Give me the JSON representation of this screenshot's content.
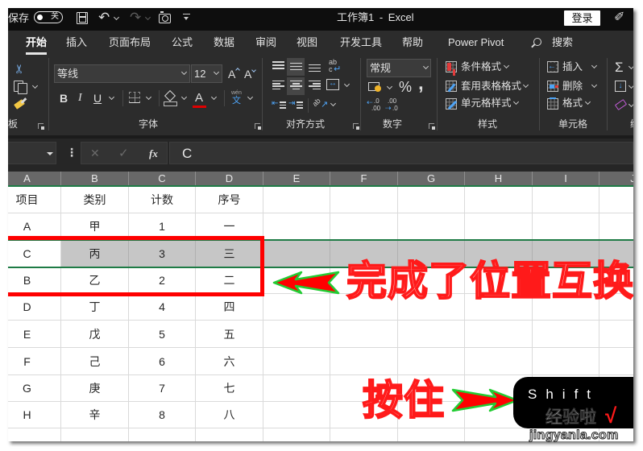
{
  "titlebar": {
    "autosave_label": "保存",
    "autosave_state": "关",
    "title": "工作簿1 - Excel",
    "signin_label": "登录"
  },
  "tabs": [
    {
      "label": "开始",
      "active": true
    },
    {
      "label": "插入"
    },
    {
      "label": "页面布局"
    },
    {
      "label": "公式"
    },
    {
      "label": "数据"
    },
    {
      "label": "审阅"
    },
    {
      "label": "视图"
    },
    {
      "label": "开发工具"
    },
    {
      "label": "帮助"
    },
    {
      "label": "Power Pivot"
    }
  ],
  "search": {
    "label": "搜索"
  },
  "ribbon": {
    "clipboard": {
      "label": "板"
    },
    "font": {
      "label": "字体",
      "name": "等线",
      "size": "12",
      "grow": "A",
      "shrink": "A",
      "bold": "B",
      "italic": "I",
      "underline": "U",
      "color_letter": "A",
      "phonetic_top": "wén",
      "phonetic_bottom": "文"
    },
    "alignment": {
      "label": "对齐方式",
      "wrap_top": "ab",
      "wrap_bottom": "c",
      "orientation": "ab"
    },
    "number": {
      "label": "数字",
      "format": "常规",
      "percent": "%",
      "comma": ",",
      "dec_short": ".0",
      "dec_long": ".00"
    },
    "styles": {
      "label": "样式",
      "items": [
        "条件格式",
        "套用表格格式",
        "单元格样式"
      ]
    },
    "cells": {
      "label": "单元格",
      "items": [
        "插入",
        "删除",
        "格式"
      ]
    },
    "editing": {
      "label": "编辑",
      "autosum": "Σ"
    }
  },
  "icons": {
    "scissors": "✂",
    "undo": "↶",
    "redo": "↷",
    "pen": "✐",
    "wrap_arrow": "↵",
    "merge_arrows": "↔",
    "indent_decrease": "⇤",
    "indent_increase": "⇥",
    "orientation_arrow": "↗",
    "decimal_left": "⇠",
    "decimal_right": "⇢",
    "fill_down": "↓",
    "more": "⋮",
    "cancel": "✕",
    "enter": "✓"
  },
  "formula_bar": {
    "name_box": "",
    "fx": "fx",
    "value": "C"
  },
  "sheet": {
    "columns": [
      "A",
      "B",
      "C",
      "D",
      "E",
      "F",
      "G",
      "H",
      "I",
      "J"
    ],
    "rows": [
      [
        "项目",
        "类别",
        "计数",
        "序号"
      ],
      [
        "A",
        "甲",
        "1",
        "一"
      ],
      [
        "C",
        "丙",
        "3",
        "三"
      ],
      [
        "B",
        "乙",
        "2",
        "二"
      ],
      [
        "D",
        "丁",
        "4",
        "四"
      ],
      [
        "E",
        "戊",
        "5",
        "五"
      ],
      [
        "F",
        "己",
        "6",
        "六"
      ],
      [
        "G",
        "庚",
        "7",
        "七"
      ],
      [
        "H",
        "辛",
        "8",
        "八"
      ],
      [
        "",
        "",
        "",
        ""
      ]
    ],
    "highlighted_row_index": 2
  },
  "annotations": {
    "swap_done_text": "完成了位置互换",
    "hold_text": "按住",
    "key_label": "Shift",
    "watermark_cn": "经验啦",
    "watermark_check": "√",
    "watermark_url": "jingyanla.com"
  },
  "colors": {
    "excel_green": "#1e7b45",
    "annotation_red": "#ff0000",
    "annotation_arrow_outline": "#22cc33",
    "font_color_bar": "#e00000",
    "highlight_row": "#c6c6c6"
  }
}
